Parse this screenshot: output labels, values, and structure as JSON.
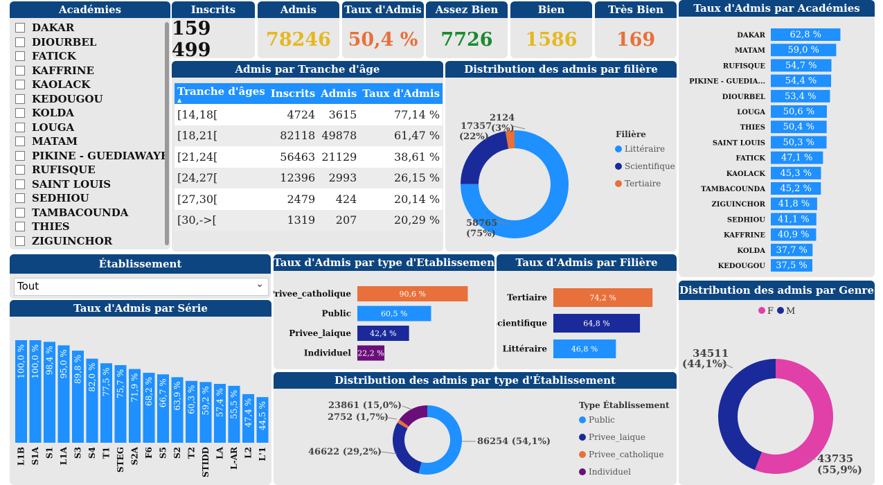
{
  "academies_panel": {
    "title": "Académies",
    "items": [
      "DAKAR",
      "DIOURBEL",
      "FATICK",
      "KAFFRINE",
      "KAOLACK",
      "KEDOUGOU",
      "KOLDA",
      "LOUGA",
      "MATAM",
      "PIKINE - GUEDIAWAYE",
      "RUFISQUE",
      "SAINT LOUIS",
      "SEDHIOU",
      "TAMBACOUNDA",
      "THIES",
      "ZIGUINCHOR"
    ]
  },
  "kpis": [
    {
      "title": "Inscrits",
      "value": "159 499",
      "color": "#111111"
    },
    {
      "title": "Admis",
      "value": "78246",
      "color": "#e6b820"
    },
    {
      "title": "Taux d'Admis",
      "value": "50,4 %",
      "color": "#e8703a"
    },
    {
      "title": "Assez Bien",
      "value": "7726",
      "color": "#1a8a2e"
    },
    {
      "title": "Bien",
      "value": "1586",
      "color": "#e6b820"
    },
    {
      "title": "Très Bien",
      "value": "169",
      "color": "#e8703a"
    }
  ],
  "age_table": {
    "title": "Admis par Tranche d'âge",
    "columns": [
      "Tranche d'âges",
      "Inscrits",
      "Admis",
      "Taux d'Admis"
    ],
    "rows": [
      [
        "[14,18[",
        "4724",
        "3615",
        "77,14 %"
      ],
      [
        "[18,21[",
        "82118",
        "49878",
        "61,47 %"
      ],
      [
        "[21,24[",
        "56463",
        "21129",
        "38,61 %"
      ],
      [
        "[24,27[",
        "12396",
        "2993",
        "26,15 %"
      ],
      [
        "[27,30[",
        "2479",
        "424",
        "20,14 %"
      ],
      [
        "[30,->[",
        "1319",
        "207",
        "20,29 %"
      ]
    ]
  },
  "filiere_donut": {
    "title": "Distribution des admis par filière",
    "legend_title": "Filière",
    "label_litt_value": "58765",
    "label_litt_pct": "(75%)",
    "label_sci_value": "17357",
    "label_sci_pct": "(22%)",
    "label_ter_value": "2124",
    "label_ter_pct": "(3%)"
  },
  "etab_filter": {
    "title": "Établissement",
    "value": "Tout"
  },
  "type_etab_bars": {
    "title": "Taux d'Admis par type d'Etablissement"
  },
  "filiere_bars": {
    "title": "Taux d'Admis par Filière"
  },
  "serie_bars": {
    "title": "Taux d'Admis par Série"
  },
  "type_etab_donut": {
    "title": "Distribution des admis par type d'Établissement",
    "legend_title": "Type Établissement",
    "label_public": "86254 (54,1%)",
    "label_laique": "46622 (29,2%)",
    "label_catho": "2752 (1,7%)",
    "label_indiv": "23861 (15,0%)"
  },
  "academie_bars": {
    "title": "Taux d'Admis par Académies"
  },
  "genre_donut": {
    "title": "Distribution des admis par Genre",
    "legend": [
      "F",
      "M"
    ],
    "label_m_value": "34511",
    "label_m_pct": "(44,1%)",
    "label_f_value": "43735",
    "label_f_pct": "(55,9%)"
  },
  "chart_data": [
    {
      "type": "bar",
      "orientation": "horizontal",
      "title": "Taux d'Admis par Académies",
      "categories": [
        "DAKAR",
        "MATAM",
        "RUFISQUE",
        "PIKINE - GUEDIA...",
        "DIOURBEL",
        "LOUGA",
        "THIES",
        "SAINT LOUIS",
        "FATICK",
        "KAOLACK",
        "TAMBACOUNDA",
        "ZIGUINCHOR",
        "SEDHIOU",
        "KAFFRINE",
        "KOLDA",
        "KEDOUGOU"
      ],
      "values": [
        62.8,
        59.0,
        54.7,
        54.4,
        53.4,
        50.6,
        50.4,
        50.3,
        47.1,
        45.3,
        45.2,
        41.8,
        41.1,
        40.9,
        37.7,
        37.5
      ],
      "labels": [
        "62,8 %",
        "59,0 %",
        "54,7 %",
        "54,4 %",
        "53,4 %",
        "50,6 %",
        "50,4 %",
        "50,3 %",
        "47,1 %",
        "45,3 %",
        "45,2 %",
        "41,8 %",
        "41,1 %",
        "40,9 %",
        "37,7 %",
        "37,5 %"
      ],
      "color": "#1e90ff"
    },
    {
      "type": "bar",
      "orientation": "horizontal",
      "title": "Taux d'Admis par type d'Etablissement",
      "categories": [
        "Privee_catholique",
        "Public",
        "Privee_laique",
        "Individuel"
      ],
      "values": [
        90.6,
        60.5,
        42.4,
        22.2
      ],
      "labels": [
        "90,6 %",
        "60,5 %",
        "42,4 %",
        "22,2 %"
      ],
      "colors": [
        "#e8703a",
        "#1e90ff",
        "#1a2a9a",
        "#6a0f7a"
      ]
    },
    {
      "type": "bar",
      "orientation": "horizontal",
      "title": "Taux d'Admis par Filière",
      "categories": [
        "Tertiaire",
        "Scientifique",
        "Littéraire"
      ],
      "values": [
        74.2,
        64.8,
        46.8
      ],
      "labels": [
        "74,2 %",
        "64,8 %",
        "46,8 %"
      ],
      "colors": [
        "#e8703a",
        "#1a2a9a",
        "#1e90ff"
      ]
    },
    {
      "type": "bar",
      "orientation": "vertical",
      "title": "Taux d'Admis par Série",
      "categories": [
        "L1B",
        "S1A",
        "S1",
        "L1A",
        "S3",
        "S4",
        "T1",
        "STEG",
        "S2A",
        "F6",
        "S5",
        "S2",
        "T2",
        "STIDD",
        "LA",
        "L-AR",
        "L2",
        "L'1"
      ],
      "values": [
        100.0,
        100.0,
        98.4,
        95.0,
        89.8,
        82.0,
        77.5,
        75.7,
        71.9,
        68.2,
        66.7,
        63.9,
        60.3,
        59.2,
        57.4,
        55.5,
        47.4,
        44.5
      ],
      "labels": [
        "100,0 %",
        "100,0 %",
        "98,4 %",
        "95,0 %",
        "89,8 %",
        "82,0 %",
        "77,5 %",
        "75,7 %",
        "71,9 %",
        "68,2 %",
        "66,7 %",
        "63,9 %",
        "60,3 %",
        "59,2 %",
        "57,4 %",
        "55,5 %",
        "47,4 %",
        "44,5 %"
      ],
      "color": "#1e90ff"
    },
    {
      "type": "pie",
      "style": "donut",
      "title": "Distribution des admis par filière",
      "categories": [
        "Littéraire",
        "Scientifique",
        "Tertiaire"
      ],
      "values": [
        58765,
        17357,
        2124
      ],
      "colors": [
        "#1e90ff",
        "#1a2a9a",
        "#e8703a"
      ]
    },
    {
      "type": "pie",
      "style": "donut",
      "title": "Distribution des admis par type d'Établissement",
      "categories": [
        "Public",
        "Privee_laique",
        "Privee_catholique",
        "Individuel"
      ],
      "values": [
        86254,
        46622,
        2752,
        23861
      ],
      "colors": [
        "#1e90ff",
        "#1a2a9a",
        "#e8703a",
        "#6a0f7a"
      ]
    },
    {
      "type": "pie",
      "style": "donut",
      "title": "Distribution des admis par Genre",
      "categories": [
        "F",
        "M"
      ],
      "values": [
        43735,
        34511
      ],
      "colors": [
        "#e040a8",
        "#1a2a9a"
      ]
    }
  ]
}
